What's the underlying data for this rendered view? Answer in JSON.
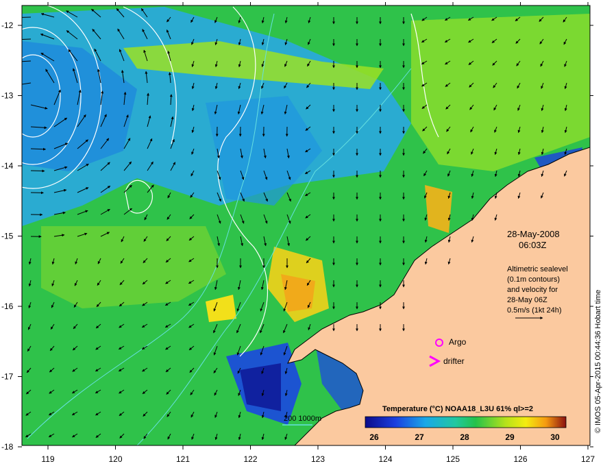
{
  "map": {
    "x_axis": {
      "ticks": [
        "119",
        "120",
        "121",
        "122",
        "123",
        "124",
        "125",
        "126",
        "127"
      ]
    },
    "y_axis": {
      "ticks": [
        "-12",
        "-13",
        "-14",
        "-15",
        "-16",
        "-17",
        "-18"
      ]
    },
    "date": "28-May-2008",
    "time": "06:03Z",
    "altimetry_lines": [
      "Altimetric sealevel",
      "(0.1m contours)",
      "and velocity for",
      "28-May 06Z",
      "0.5m/s (1kt 24h)"
    ],
    "legend": {
      "argo": "Argo",
      "drifter": "drifter"
    },
    "bathymetry_label": "200  1000m",
    "colorbar": {
      "title": "Temperature (°C) NOAA18_L3U 61% ql>=2",
      "ticks": [
        "26",
        "27",
        "28",
        "29",
        "30"
      ]
    },
    "credit": "© IMOS 05-Apr-2015 00:44:36 Hobart time",
    "colors": {
      "land": "#fbc99f",
      "argo": "#ff00ff",
      "drifter": "#ff00ff",
      "contour": "#ffffff",
      "bathymetry": "#66e0e0"
    }
  }
}
